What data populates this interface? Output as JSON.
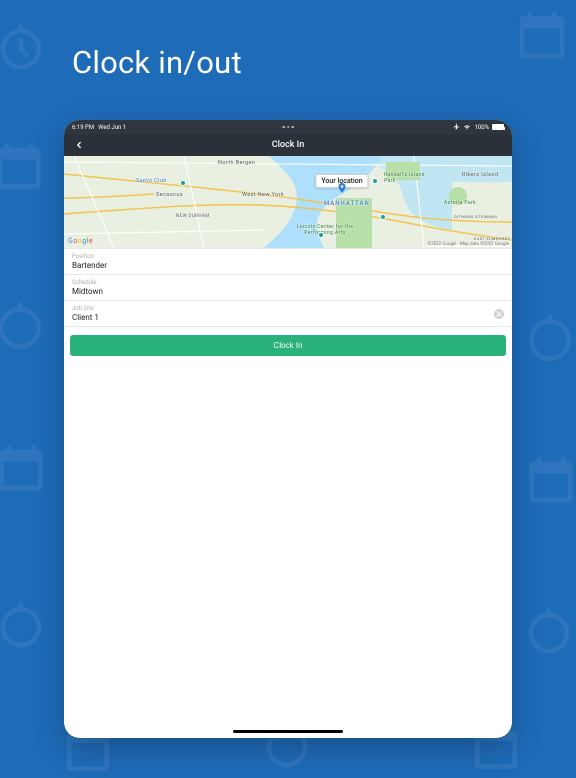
{
  "page": {
    "title": "Clock in/out"
  },
  "status_bar": {
    "time": "6:19 PM",
    "date": "Wed Jun 1",
    "battery_pct": "100%"
  },
  "nav": {
    "title": "Clock In"
  },
  "map": {
    "location_label": "Your location",
    "logo": "Google",
    "attribution": "©2022 Google - Map data ©2022 Google",
    "labels": {
      "north_bergen": "North Bergen",
      "secaucus": "Secaucus",
      "west_new_york": "West New York",
      "new_durham": "NEW DURHAM",
      "manhattan": "MANHATTAN",
      "lincoln_center": "Lincoln Center for the Performing Arts",
      "sams_club": "Sam's Club",
      "randalls": "Randall's Island Park",
      "astoria_park": "Astoria Park",
      "ditmars": "DITMARS STEINWAY",
      "rikers": "Rikers Island",
      "east_elmhurst": "EAST ELMHURST"
    }
  },
  "form": {
    "position": {
      "label": "Position",
      "value": "Bartender"
    },
    "schedule": {
      "label": "Schedule",
      "value": "Midtown"
    },
    "job_site": {
      "label": "Job Site",
      "value": "Client 1"
    }
  },
  "actions": {
    "clock_in": "Clock In"
  }
}
